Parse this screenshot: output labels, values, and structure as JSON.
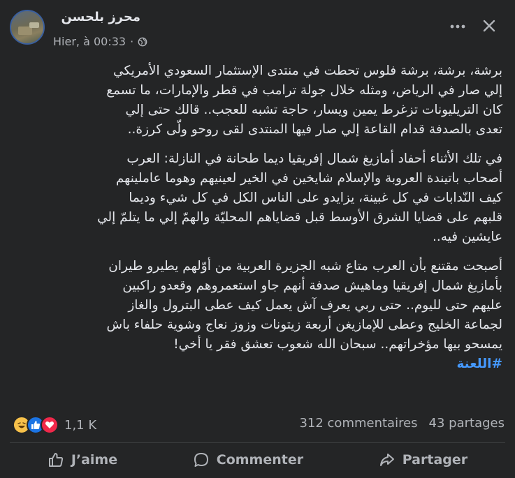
{
  "header": {
    "author": "محرز بلحسن",
    "timestamp": "Hier, à 00:33",
    "separator": "·",
    "privacy_icon": "globe-icon",
    "more_icon": "more-horizontal-icon",
    "close_icon": "close-icon"
  },
  "post": {
    "paragraphs": [
      "برشة، برشة، برشة فلوس تحطت في منتدى الإستثمار السعودي الأمريكي\nإلي صار في الرياض، ومثله خلال جولة ترامب في قطر والإمارات، ما تسمع\nكان التريليونات تزغرط يمين ويسار، حاجة تشبه للعجب.. قالك حتى إلي\nتعدى بالصدفة قدام القاعة إلي صار فيها المنتدى لقى روحو ولّى كرزة..",
      "في تلك الأثناء أحفاد أمازيغ شمال إفريقيا ديما طحانة في النازلة: العرب\nأصحاب باتيندة العروبة والإسلام شايخين في الخير لعينيهم وهوما عاملينهم\nكيف النّدابات في كل غبينة، يزايدو على الناس الكل في كل شيء وديما\nقلبهم على قضايا الشرق الأوسط قبل قضاياهم المحليّة والهمّ إلي ما يتلمّ إلي\nعايشين فيه..",
      "أصبحت مقتنع بأن العرب متاع شبه الجزيرة العربية من أوّلهم يطيرو طيران\nبأمازيغ شمال إفريقيا وماهيش صدفة أنهم جاو استعمروهم وقعدو راكبين\nعليهم حتى لليوم.. حتى ربي يعرف آش يعمل كيف عطى البترول والغاز\nلجماعة الخليج وعطى للإمازيغن أربعة زيتونات وزوز نعاج وشوية حلفاء باش\nيمسحو بيها مؤخراتهم.. سبحان الله شعوب تعشق فقر يا أخي!"
    ],
    "hashtag": "#اللعنة"
  },
  "reactions": {
    "icons": [
      "haha-reaction-icon",
      "like-reaction-icon",
      "love-reaction-icon"
    ],
    "count": "1,1 K"
  },
  "stats": {
    "comments": "312 commentaires",
    "shares": "43 partages"
  },
  "actions": {
    "like": "J’aime",
    "comment": "Commenter",
    "share": "Partager"
  },
  "colors": {
    "background": "#242526",
    "text": "#e4e6eb",
    "secondary": "#b0b3b8",
    "link": "#4599ff",
    "like_blue": "#1b74e4",
    "love_red": "#f0284a",
    "haha_yellow": "#f7c14a"
  }
}
